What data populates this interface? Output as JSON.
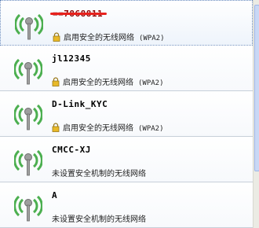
{
  "networks": [
    {
      "ssid": "==7868811",
      "status": "启用安全的无线网络",
      "protocol": "(WPA2)",
      "secured": true,
      "selected": true
    },
    {
      "ssid": "jl12345",
      "status": "启用安全的无线网络",
      "protocol": "(WPA2)",
      "secured": true,
      "selected": false
    },
    {
      "ssid": "D-Link_KYC",
      "status": "启用安全的无线网络",
      "protocol": "(WPA2)",
      "secured": true,
      "selected": false
    },
    {
      "ssid": "CMCC-XJ",
      "status": "未设置安全机制的无线网络",
      "protocol": "",
      "secured": false,
      "selected": false
    },
    {
      "ssid": "A",
      "status": "未设置安全机制的无线网络",
      "protocol": "",
      "secured": false,
      "selected": false
    }
  ],
  "icons": {
    "signal": "wifi-signal-icon",
    "lock": "lock-icon"
  },
  "colors": {
    "signal_green": "#3aa83a",
    "redaction": "#e8211c",
    "lock_gold": "#d9a520"
  }
}
